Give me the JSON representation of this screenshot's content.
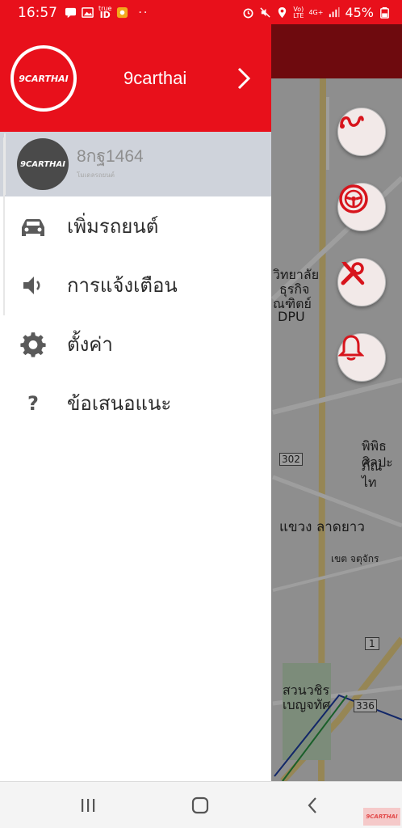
{
  "status_bar": {
    "time": "16:57",
    "left_small_1": "true",
    "left_small_2": "ID",
    "dots": "··",
    "network_label_1": "Vo)",
    "network_label_2": "LTE",
    "network_label_3": "4G+",
    "battery": "45%"
  },
  "drawer": {
    "brand_logo_text": "9CARTHAI",
    "brand_name": "9carthai",
    "vehicle": {
      "avatar_text": "9CARTHAI",
      "plate": "8กฐ1464",
      "subtitle": "โมเดลรถยนต์"
    },
    "menu": [
      {
        "label": "เพิ่มรถยนต์",
        "icon": "car-icon"
      },
      {
        "label": "การแจ้งเตือน",
        "icon": "speaker-icon"
      },
      {
        "label": "ตั้งค่า",
        "icon": "gear-icon"
      },
      {
        "label": "ข้อเสนอแนะ",
        "icon": "question-icon"
      }
    ]
  },
  "map": {
    "labels": {
      "university_1": "วิทยาลัย",
      "university_2": "ธุรกิจ",
      "university_3": "ณฑิตย์",
      "university_4": "DPU",
      "place_1": "พิพิธภัณ",
      "place_2": "ศิลปะไท",
      "district": "แขวง ลาดยาว",
      "district_small": "เขต จตุจักร",
      "park_1": "สวนวชิร",
      "park_2": "เบญจทัศ",
      "road_302": "302",
      "road_336": "336",
      "road_1": "1"
    },
    "theme": {
      "header_color": "#e8101b",
      "fab_icon_color": "#d7141c"
    }
  },
  "navbar": {
    "watermark": "9CARTHAI"
  }
}
